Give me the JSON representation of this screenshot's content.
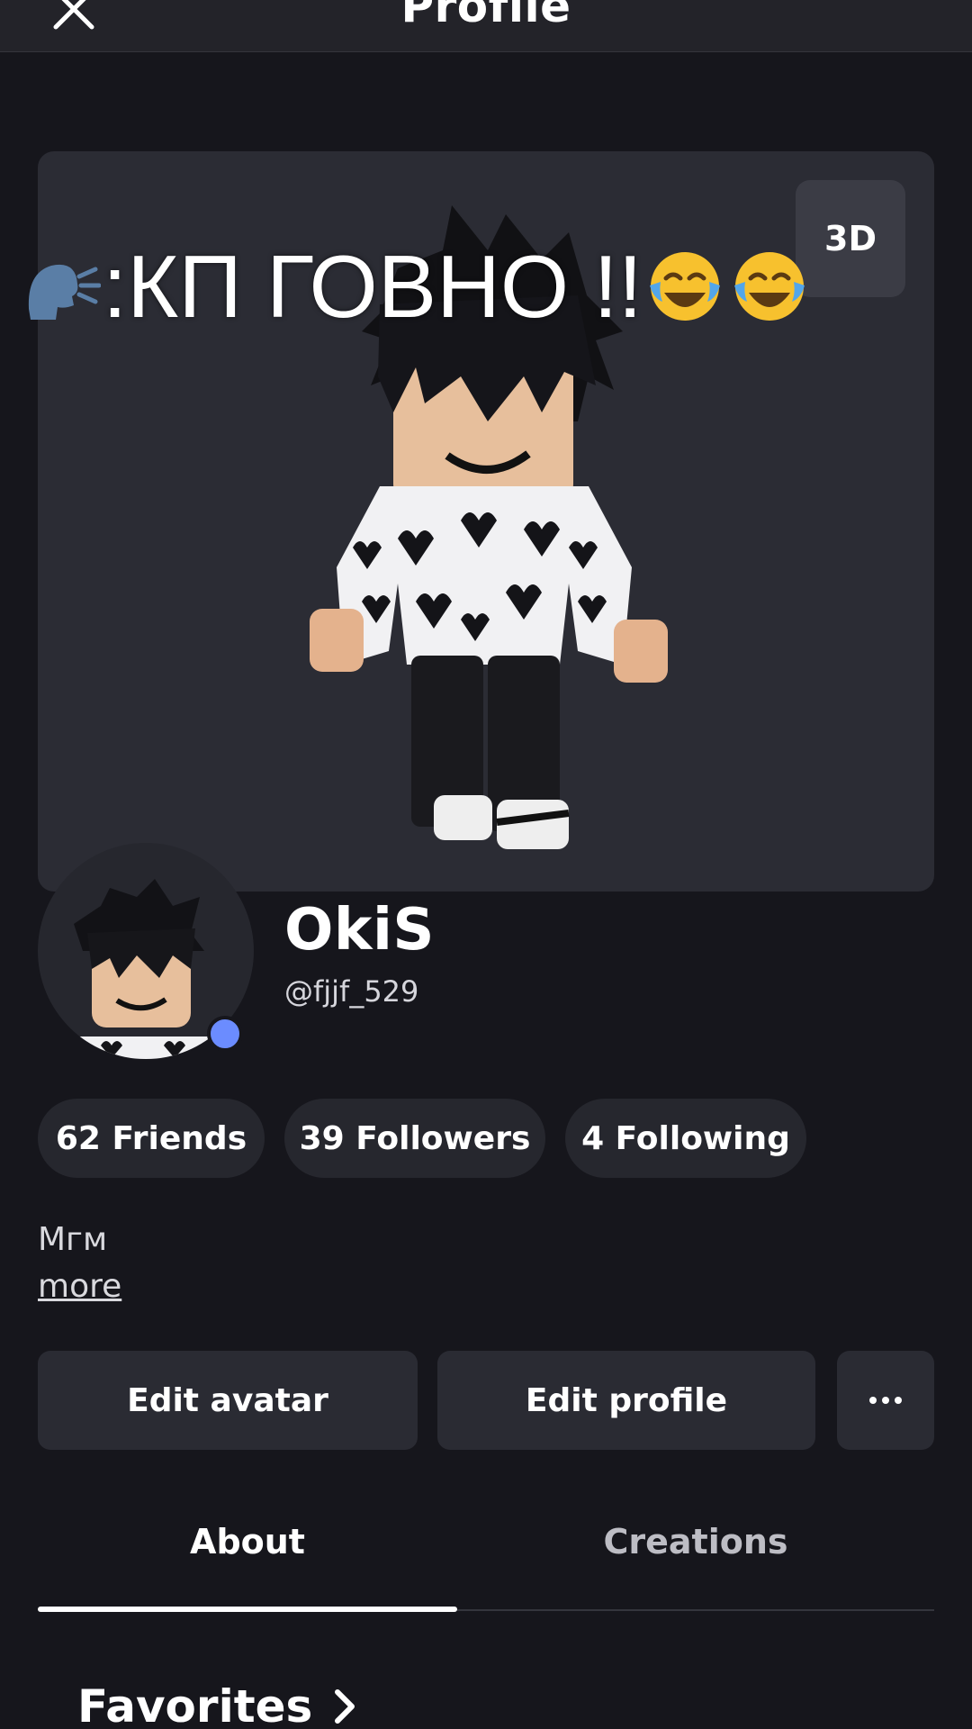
{
  "header": {
    "title": "Profile",
    "close_icon": "close-icon"
  },
  "avatar_view": {
    "toggle_3d_label": "3D"
  },
  "overlay_caption": {
    "text": ":КП ГОВНО !!",
    "leading_icon": "speaking-head-icon",
    "trailing_icons": [
      "tears-of-joy-icon",
      "tears-of-joy-icon"
    ]
  },
  "profile": {
    "display_name": "OkiS",
    "username": "@fjjf_529",
    "status_color": "#6b8cff"
  },
  "stats": {
    "friends": "62 Friends",
    "followers": "39 Followers",
    "following": "4 Following"
  },
  "bio": {
    "text": "Мгм",
    "more_label": "more"
  },
  "actions": {
    "edit_avatar": "Edit avatar",
    "edit_profile": "Edit profile",
    "more_icon": "more-dots-icon"
  },
  "tabs": [
    {
      "label": "About",
      "active": true
    },
    {
      "label": "Creations",
      "active": false
    }
  ],
  "sections": {
    "favorites": "Favorites"
  },
  "colors": {
    "background": "#16161c",
    "surface": "#26272e",
    "stage": "#2b2c34",
    "text": "#ffffff",
    "online_dot": "#6b8cff"
  }
}
